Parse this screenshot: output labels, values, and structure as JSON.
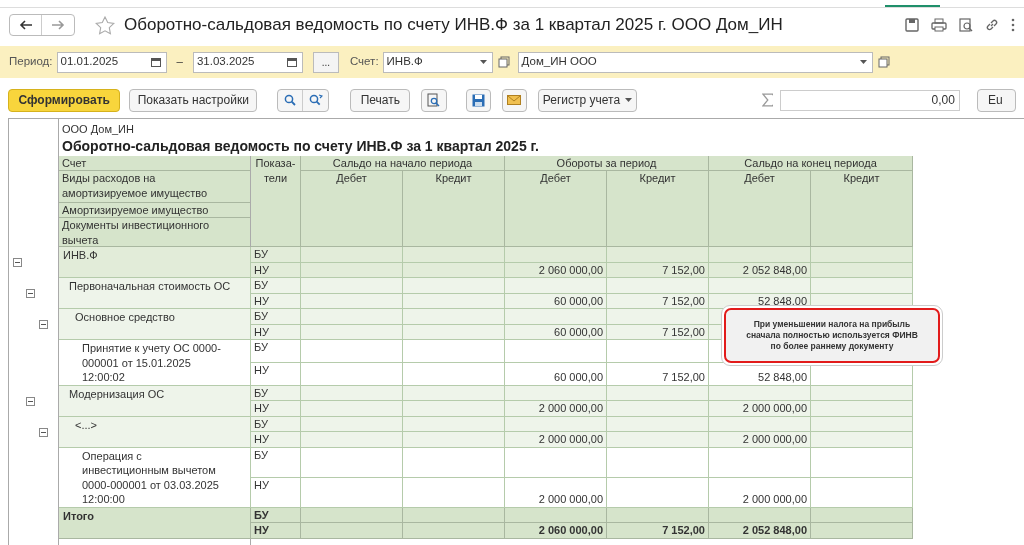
{
  "window": {
    "title": "Оборотно-сальдовая ведомость по счету ИНВ.Ф за 1 квартал 2025 г. ООО Дом_ИН",
    "favorite": false
  },
  "filters": {
    "period_label": "Период:",
    "date_from": "01.01.2025",
    "dash": "–",
    "date_to": "31.03.2025",
    "more_button": "...",
    "account_label": "Счет:",
    "account": "ИНВ.Ф",
    "organization": "Дом_ИН ООО"
  },
  "toolbar": {
    "generate": "Сформировать",
    "settings": "Показать настройки",
    "print": "Печать",
    "register": "Регистр учета",
    "sum": "0,00",
    "cut_button": "Eu"
  },
  "report": {
    "organization": "ООО Дом_ИН",
    "title": "Оборотно-сальдовая ведомость по счету ИНВ.Ф за 1 квартал 2025 г.",
    "row_headers": [
      "Счет",
      "Виды расходов на амортизируемое имущество",
      "Амортизируемое имущество",
      "Документы инвестиционного вычета"
    ],
    "indicators_header": "Показа-тели",
    "column_groups": [
      {
        "title": "Сальдо на начало периода",
        "columns": [
          "Дебет",
          "Кредит"
        ]
      },
      {
        "title": "Обороты за период",
        "columns": [
          "Дебет",
          "Кредит"
        ]
      },
      {
        "title": "Сальдо на конец периода",
        "columns": [
          "Дебет",
          "Кредит"
        ]
      }
    ],
    "rows": [
      {
        "label": "ИНВ.Ф",
        "kind": "group",
        "expanded": true,
        "values": [
          {
            "indicator": "БУ",
            "cells": [
              null,
              null,
              null,
              null,
              null,
              null
            ]
          },
          {
            "indicator": "НУ",
            "cells": [
              null,
              null,
              "2 060 000,00",
              "7 152,00",
              "2 052 848,00",
              null
            ]
          }
        ],
        "children": [
          {
            "label": "Первоначальная стоимость ОС",
            "kind": "group",
            "expanded": true,
            "values": [
              {
                "indicator": "БУ",
                "cells": [
                  null,
                  null,
                  null,
                  null,
                  null,
                  null
                ]
              },
              {
                "indicator": "НУ",
                "cells": [
                  null,
                  null,
                  "60 000,00",
                  "7 152,00",
                  "52 848,00",
                  null
                ]
              }
            ],
            "children": [
              {
                "label": "Основное средство",
                "kind": "group",
                "expanded": true,
                "values": [
                  {
                    "indicator": "БУ",
                    "cells": [
                      null,
                      null,
                      null,
                      null,
                      null,
                      null
                    ]
                  },
                  {
                    "indicator": "НУ",
                    "cells": [
                      null,
                      null,
                      "60 000,00",
                      "7 152,00",
                      null,
                      null
                    ]
                  }
                ],
                "children": [
                  {
                    "label": "Принятие к учету ОС 0000-000001 от 15.01.2025 12:00:02",
                    "kind": "document",
                    "values": [
                      {
                        "indicator": "БУ",
                        "cells": [
                          null,
                          null,
                          null,
                          null,
                          null,
                          null
                        ]
                      },
                      {
                        "indicator": "НУ",
                        "cells": [
                          null,
                          null,
                          "60 000,00",
                          "7 152,00",
                          "52 848,00",
                          null
                        ]
                      }
                    ]
                  }
                ]
              }
            ]
          },
          {
            "label": "Модернизация ОС",
            "kind": "group",
            "expanded": true,
            "values": [
              {
                "indicator": "БУ",
                "cells": [
                  null,
                  null,
                  null,
                  null,
                  null,
                  null
                ]
              },
              {
                "indicator": "НУ",
                "cells": [
                  null,
                  null,
                  "2 000 000,00",
                  null,
                  "2 000 000,00",
                  null
                ]
              }
            ],
            "children": [
              {
                "label": "<...>",
                "kind": "group",
                "expanded": true,
                "values": [
                  {
                    "indicator": "БУ",
                    "cells": [
                      null,
                      null,
                      null,
                      null,
                      null,
                      null
                    ]
                  },
                  {
                    "indicator": "НУ",
                    "cells": [
                      null,
                      null,
                      "2 000 000,00",
                      null,
                      "2 000 000,00",
                      null
                    ]
                  }
                ],
                "children": [
                  {
                    "label": "Операция с инвестиционным вычетом 0000-000001 от 03.03.2025 12:00:00",
                    "kind": "document",
                    "values": [
                      {
                        "indicator": "БУ",
                        "cells": [
                          null,
                          null,
                          null,
                          null,
                          null,
                          null
                        ]
                      },
                      {
                        "indicator": "НУ",
                        "cells": [
                          null,
                          null,
                          "2 000 000,00",
                          null,
                          "2 000 000,00",
                          null
                        ]
                      }
                    ]
                  }
                ]
              }
            ]
          }
        ]
      },
      {
        "label": "Итого",
        "kind": "total",
        "values": [
          {
            "indicator": "БУ",
            "cells": [
              null,
              null,
              null,
              null,
              null,
              null
            ]
          },
          {
            "indicator": "НУ",
            "cells": [
              null,
              null,
              "2 060 000,00",
              "7 152,00",
              "2 052 848,00",
              null
            ]
          }
        ]
      }
    ],
    "tooltip": "При уменьшении налога на прибыль сначала полностью используется ФИНВ по более раннему документу"
  }
}
